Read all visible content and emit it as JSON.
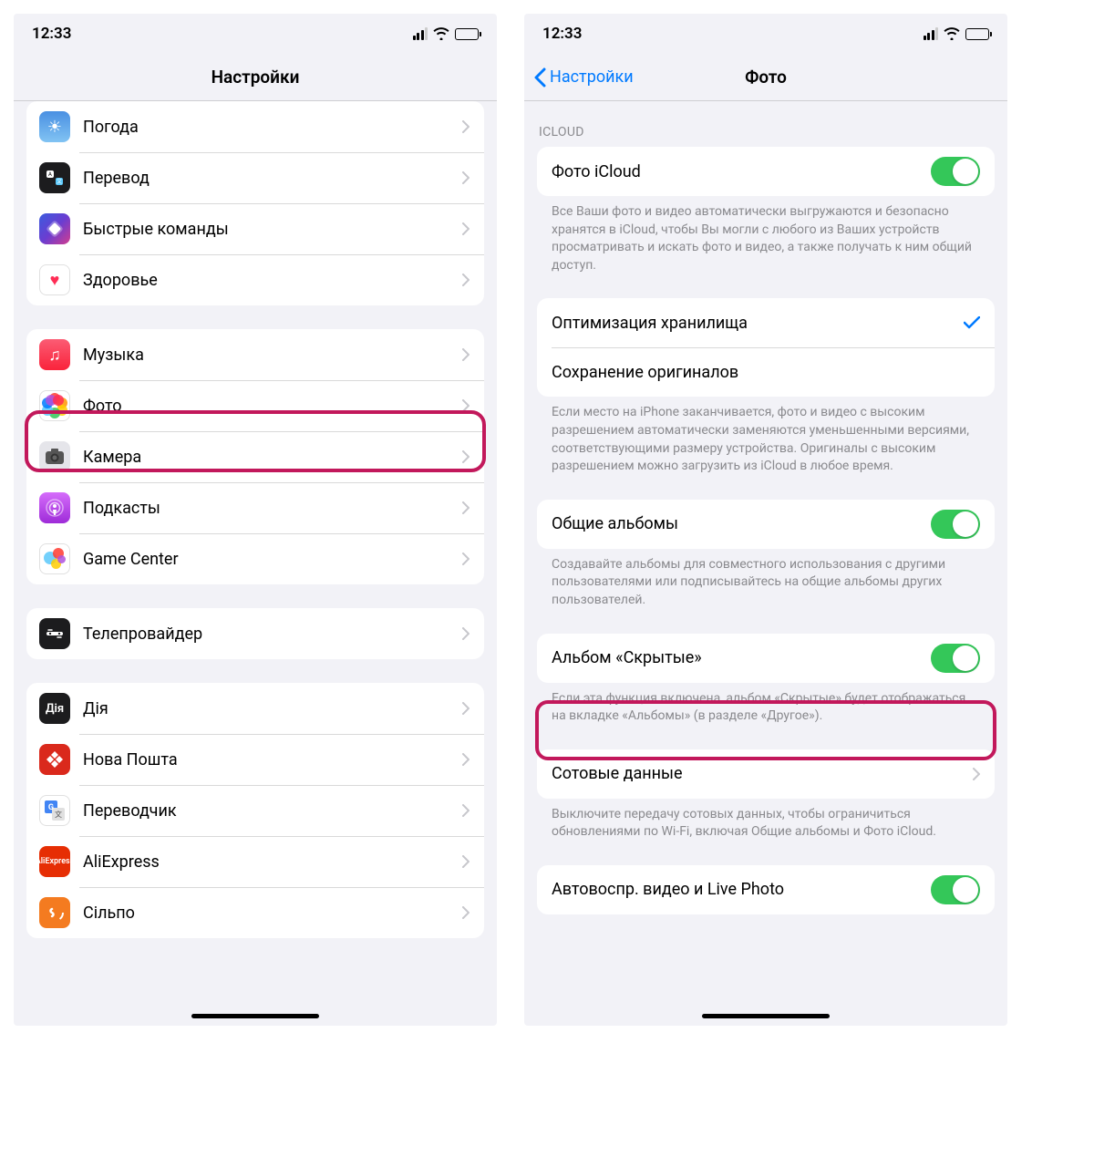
{
  "statusbar": {
    "time": "12:33"
  },
  "left": {
    "title": "Настройки",
    "groups": [
      {
        "rows": [
          {
            "icon": "weather",
            "label": "Погода"
          },
          {
            "icon": "translate",
            "label": "Перевод"
          },
          {
            "icon": "shortcuts",
            "label": "Быстрые команды"
          },
          {
            "icon": "health",
            "label": "Здоровье"
          }
        ]
      },
      {
        "rows": [
          {
            "icon": "music",
            "label": "Музыка"
          },
          {
            "icon": "photos",
            "label": "Фото"
          },
          {
            "icon": "camera",
            "label": "Камера"
          },
          {
            "icon": "podcasts",
            "label": "Подкасты"
          },
          {
            "icon": "gamecenter",
            "label": "Game Center"
          }
        ]
      },
      {
        "rows": [
          {
            "icon": "tvprovider",
            "label": "Телепровайдер"
          }
        ]
      },
      {
        "rows": [
          {
            "icon": "diia",
            "label": "Дія"
          },
          {
            "icon": "novaposhta",
            "label": "Нова Пошта"
          },
          {
            "icon": "gtranslate",
            "label": "Переводчик"
          },
          {
            "icon": "aliexpress",
            "label": "AliExpress"
          },
          {
            "icon": "silpo",
            "label": "Сільпо"
          }
        ]
      }
    ]
  },
  "right": {
    "back": "Настройки",
    "title": "Фото",
    "sectionHeader": "ICLOUD",
    "icloud": {
      "photo": "Фото iCloud",
      "photoDesc": "Все Ваши фото и видео автоматически выгружаются и безопасно хранятся в iCloud, чтобы Вы могли с любого из Ваших устройств просматривать и искать фото и видео, а также получать к ним общий доступ.",
      "optimize": "Оптимизация хранилища",
      "originals": "Сохранение оригиналов",
      "storageDesc": "Если место на iPhone заканчивается, фото и видео с высоким разрешением автоматически заменяются уменьшенными версиями, соответствующими размеру устройства. Оригиналы с высоким разрешением можно загрузить из iCloud в любое время."
    },
    "shared": {
      "label": "Общие альбомы",
      "desc": "Создавайте альбомы для совместного использования с другими пользователями или подписывайтесь на общие альбомы других пользователей."
    },
    "hidden": {
      "label": "Альбом «Скрытые»",
      "desc": "Если эта функция включена, альбом «Скрытые» будет отображаться на вкладке «Альбомы» (в разделе «Другое»)."
    },
    "cellular": {
      "label": "Сотовые данные",
      "desc": "Выключите передачу сотовых данных, чтобы ограничиться обновлениями по Wi-Fi, включая Общие альбомы и Фото iCloud."
    },
    "autoplay": {
      "label": "Автовоспр. видео и Live Photo"
    }
  }
}
